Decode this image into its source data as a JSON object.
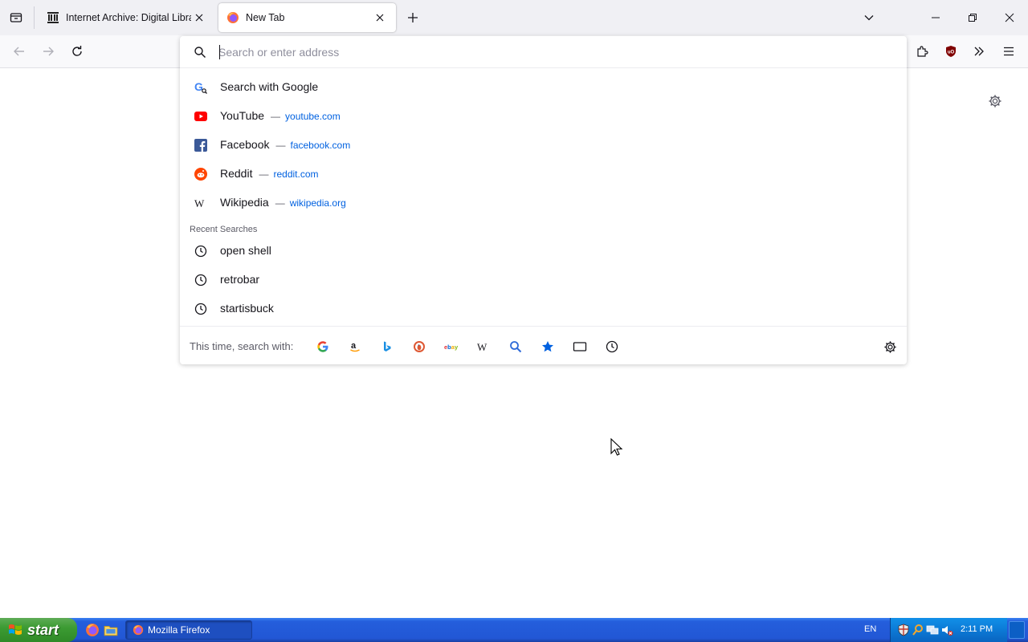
{
  "tabs": [
    {
      "title": "Internet Archive: Digital Library of Free & Borrowable Books",
      "active": false
    },
    {
      "title": "New Tab",
      "active": true
    }
  ],
  "urlbar": {
    "placeholder": "Search or enter address",
    "value": ""
  },
  "suggestions": [
    {
      "title": "Search with Google",
      "url": "",
      "icon": "google-search-icon"
    },
    {
      "title": "YouTube",
      "url": "youtube.com",
      "icon": "youtube-icon"
    },
    {
      "title": "Facebook",
      "url": "facebook.com",
      "icon": "facebook-icon"
    },
    {
      "title": "Reddit",
      "url": "reddit.com",
      "icon": "reddit-icon"
    },
    {
      "title": "Wikipedia",
      "url": "wikipedia.org",
      "icon": "wikipedia-icon"
    }
  ],
  "dash": "—",
  "recent_searches": {
    "label": "Recent Searches",
    "items": [
      "open shell",
      "retrobar",
      "startisbuck"
    ]
  },
  "oneoff": {
    "label": "This time, search with:",
    "engines": [
      "google",
      "amazon",
      "bing",
      "duckduckgo",
      "ebay",
      "wikipedia",
      "search",
      "bookmarks",
      "tabs",
      "history"
    ]
  },
  "taskbar": {
    "start_label": "start",
    "task_label": "Mozilla Firefox",
    "language": "EN",
    "clock": "2:11 PM"
  },
  "colors": {
    "accent": "#0061e0",
    "taskbar": "#245edc",
    "start": "#3c9b33"
  }
}
